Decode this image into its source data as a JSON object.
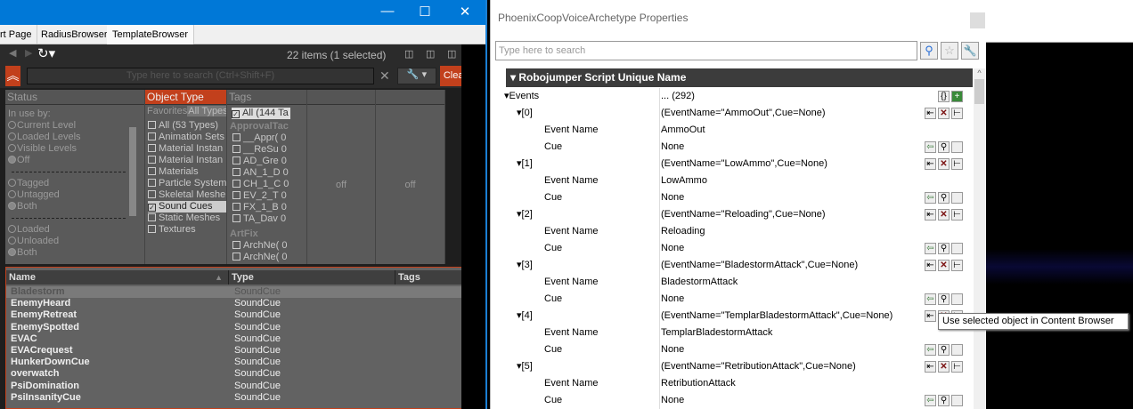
{
  "left_window": {
    "tabs": [
      "rt Page",
      "RadiusBrowser",
      "TemplateBrowser"
    ],
    "item_count": "22 items (1 selected)",
    "search_placeholder": "Type here to search  (Ctrl+Shift+F)",
    "clear_label": "Clear",
    "status": {
      "header": "Status",
      "in_use_label": "In use by:",
      "in_use": [
        "Current Level",
        "Loaded Levels",
        "Visible Levels",
        "Off"
      ],
      "tagged": [
        "Tagged",
        "Untagged",
        "Both"
      ],
      "loaded": [
        "Loaded",
        "Unloaded",
        "Both"
      ]
    },
    "object_type": {
      "header": "Object Type",
      "tab_favorites": "Favorites",
      "tab_all": "All Types",
      "items": [
        "All (53 Types)",
        "Animation Sets",
        "Material Instan",
        "Material Instan",
        "Materials",
        "Particle System",
        "Skeletal Meshe",
        "Sound Cues",
        "Static Meshes",
        "Textures"
      ],
      "checked_index": 7
    },
    "tags": {
      "header": "Tags",
      "all": "All (144 Ta",
      "group1": "ApprovalTac",
      "items": [
        "__Appr( 0",
        "__ReSu 0",
        "AD_Gre 0",
        "AN_1_D 0",
        "CH_1_C 0",
        "EV_2_T 0",
        "FX_1_B 0",
        "TA_Dav 0"
      ],
      "group2": "ArtFix",
      "items2": [
        "ArchNe( 0",
        "ArchNe( 0"
      ]
    },
    "off_columns": [
      "off",
      "off"
    ],
    "results": {
      "columns": [
        "Name",
        "Type",
        "Tags"
      ],
      "rows": [
        {
          "name": "Bladestorm",
          "type": "SoundCue"
        },
        {
          "name": "EnemyHeard",
          "type": "SoundCue"
        },
        {
          "name": "EnemyRetreat",
          "type": "SoundCue"
        },
        {
          "name": "EnemySpotted",
          "type": "SoundCue"
        },
        {
          "name": "EVAC",
          "type": "SoundCue"
        },
        {
          "name": "EVACrequest",
          "type": "SoundCue"
        },
        {
          "name": "HunkerDownCue",
          "type": "SoundCue"
        },
        {
          "name": "overwatch",
          "type": "SoundCue"
        },
        {
          "name": "PsiDomination",
          "type": "SoundCue"
        },
        {
          "name": "PsiInsanityCue",
          "type": "SoundCue"
        }
      ]
    }
  },
  "properties": {
    "title": "PhoenixCoopVoiceArchetype Properties",
    "search_placeholder": "Type here to search",
    "category": "Robojumper Script Unique Name",
    "events_label": "Events",
    "events_value": "... (292)",
    "event_name_label": "Event Name",
    "cue_label": "Cue",
    "items": [
      {
        "index": "[0]",
        "summary": "(EventName=\"AmmoOut\",Cue=None)",
        "event_name": "AmmoOut",
        "cue": "None"
      },
      {
        "index": "[1]",
        "summary": "(EventName=\"LowAmmo\",Cue=None)",
        "event_name": "LowAmmo",
        "cue": "None"
      },
      {
        "index": "[2]",
        "summary": "(EventName=\"Reloading\",Cue=None)",
        "event_name": "Reloading",
        "cue": "None"
      },
      {
        "index": "[3]",
        "summary": "(EventName=\"BladestormAttack\",Cue=None)",
        "event_name": "BladestormAttack",
        "cue": "None"
      },
      {
        "index": "[4]",
        "summary": "(EventName=\"TemplarBladestormAttack\",Cue=None)",
        "event_name": "TemplarBladestormAttack",
        "cue": "None"
      },
      {
        "index": "[5]",
        "summary": "(EventName=\"RetributionAttack\",Cue=None)",
        "event_name": "RetributionAttack",
        "cue": "None"
      }
    ],
    "tooltip": "Use selected object in Content Browser"
  },
  "colors": {
    "accent": "#c2401c",
    "titlebar": "#0078d7"
  }
}
